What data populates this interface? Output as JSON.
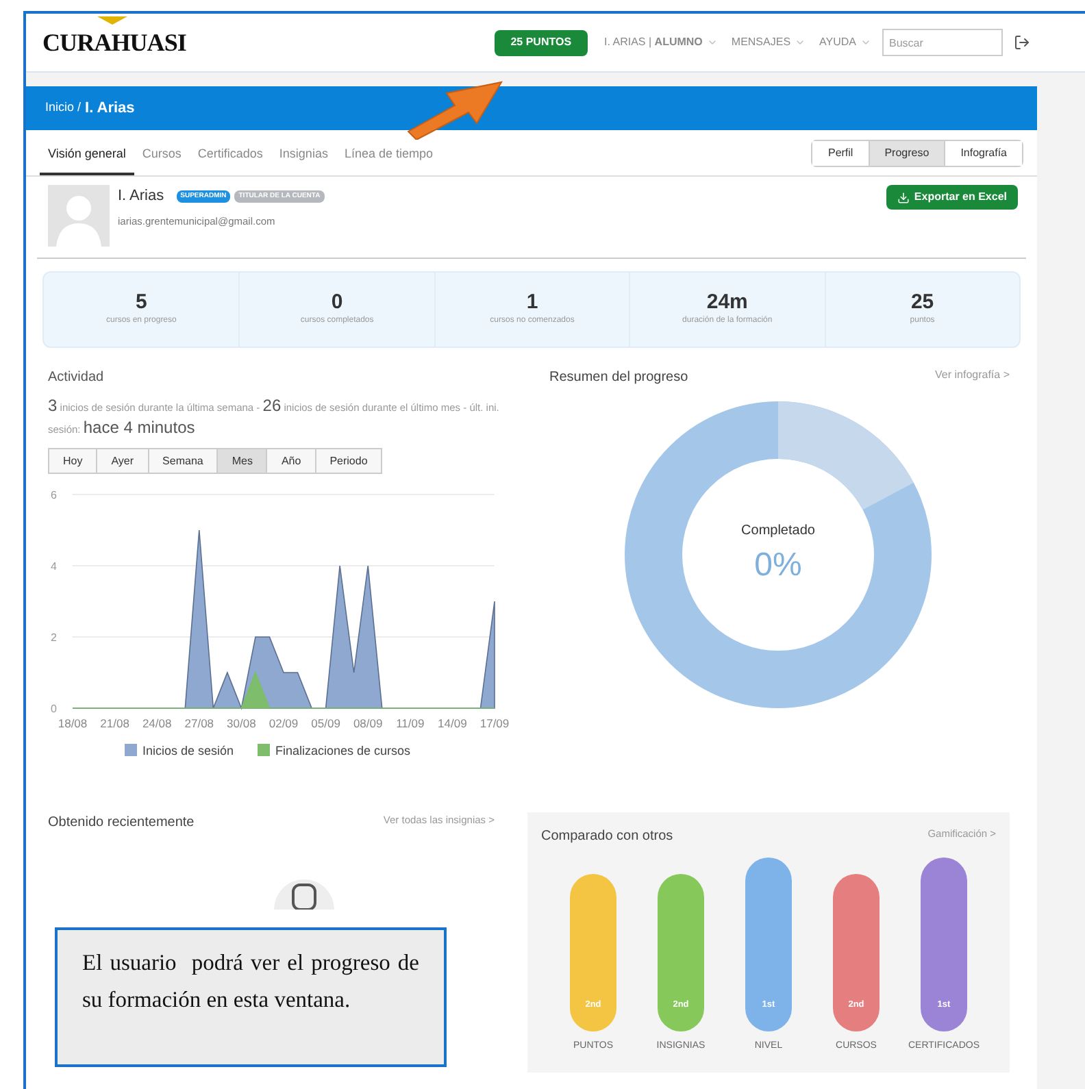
{
  "header": {
    "logo": "CURAHUASI",
    "points_button": "25 PUNTOS",
    "user": "I. ARIAS | **ALUMNO**",
    "menus": [
      {
        "label": "MENSAJES"
      },
      {
        "label": "AYUDA"
      }
    ],
    "search": {
      "placeholder": "Buscar"
    }
  },
  "breadcrumb": {
    "parent": "Inicio /",
    "current": "I. Arias"
  },
  "tabs": [
    {
      "label": "Visión general",
      "selected": true
    },
    {
      "label": "Cursos",
      "selected": false
    },
    {
      "label": "Certificados",
      "selected": false
    },
    {
      "label": "Insignias",
      "selected": false
    },
    {
      "label": "Línea de tiempo",
      "selected": false
    }
  ],
  "view_buttons": [
    {
      "label": "Perfil",
      "selected": false
    },
    {
      "label": "Progreso",
      "selected": true
    },
    {
      "label": "Infografía",
      "selected": false
    }
  ],
  "profile": {
    "name": "I. Arias",
    "badges": [
      {
        "label": "SUPERADMIN",
        "color": "#1e90e0"
      },
      {
        "label": "TITULAR DE LA CUENTA",
        "color": "#b5b8bc"
      }
    ],
    "email": "iarias.grentemunicipal@gmail.com",
    "export_button": "Exportar en Excel"
  },
  "stats": [
    {
      "value": "5",
      "label": "cursos en progreso"
    },
    {
      "value": "0",
      "label": "cursos completados"
    },
    {
      "value": "1",
      "label": "cursos no comenzados"
    },
    {
      "value": "24m",
      "label": "duración de la formación"
    },
    {
      "value": "25",
      "label": "puntos"
    }
  ],
  "activity": {
    "title": "Actividad",
    "summary": [
      {
        "text": "3",
        "kind": "big"
      },
      {
        "text": " inicios de sesión durante la última semana - ",
        "kind": "small"
      },
      {
        "text": "26",
        "kind": "big"
      },
      {
        "text": " inicios de sesión durante el último mes - últ. ini. sesión: ",
        "kind": "small"
      },
      {
        "text": "hace 4 minutos",
        "kind": "big"
      }
    ],
    "periods": [
      {
        "label": "Hoy",
        "selected": false
      },
      {
        "label": "Ayer",
        "selected": false
      },
      {
        "label": "Semana",
        "selected": false
      },
      {
        "label": "Mes",
        "selected": true
      },
      {
        "label": "Año",
        "selected": false
      },
      {
        "label": "Periodo",
        "selected": false
      }
    ],
    "chart_data": {
      "type": "area",
      "legend": "bottom",
      "categories": [
        "18/08",
        null,
        null,
        "21/08",
        null,
        null,
        "24/08",
        null,
        null,
        "27/08",
        null,
        null,
        "30/08",
        null,
        null,
        "02/09",
        null,
        null,
        "05/09",
        null,
        null,
        "08/09",
        null,
        null,
        "11/09",
        null,
        null,
        "14/09",
        null,
        null,
        "17/09"
      ],
      "series": [
        {
          "name": "Inicios de sesión",
          "color": "#8ea8cf",
          "values": [
            0,
            0,
            0,
            0,
            0,
            0,
            0,
            0,
            0,
            5,
            0,
            1,
            0,
            2,
            2,
            1,
            1,
            0,
            0,
            4,
            1,
            4,
            0,
            0,
            0,
            0,
            0,
            0,
            0,
            0,
            3
          ]
        },
        {
          "name": "Finalizaciones de cursos",
          "color": "#7dbd6b",
          "values": [
            0,
            0,
            0,
            0,
            0,
            0,
            0,
            0,
            0,
            0,
            0,
            0,
            0,
            1,
            0,
            0,
            0,
            0,
            0,
            0,
            0,
            0,
            0,
            0,
            0,
            0,
            0,
            0,
            0,
            0,
            0
          ]
        }
      ],
      "ylim": [
        0,
        6
      ],
      "yticks": [
        0,
        2,
        4,
        6
      ]
    }
  },
  "progress": {
    "title": "Resumen del progreso",
    "link": "Ver infografía >",
    "center_label": "Completado",
    "center_value": "0%"
  },
  "recent": {
    "title": "Obtenido recientemente",
    "link": "Ver todas las insignias >"
  },
  "comparison": {
    "title": "Comparado con otros",
    "link": "Gamificación >",
    "items": [
      {
        "label": "PUNTOS",
        "rank": "2nd",
        "color": "#f4c542",
        "kind": "short"
      },
      {
        "label": "INSIGNIAS",
        "rank": "2nd",
        "color": "#86c95a",
        "kind": "short"
      },
      {
        "label": "NIVEL",
        "rank": "1st",
        "color": "#7db3e8",
        "kind": "tall"
      },
      {
        "label": "CURSOS",
        "rank": "2nd",
        "color": "#e57f7f",
        "kind": "short"
      },
      {
        "label": "CERTIFICADOS",
        "rank": "1st",
        "color": "#9b84d6",
        "kind": "tall"
      }
    ]
  },
  "annotation": {
    "text": "El usuario  podrá ver el progreso de su formación en esta ventana."
  }
}
